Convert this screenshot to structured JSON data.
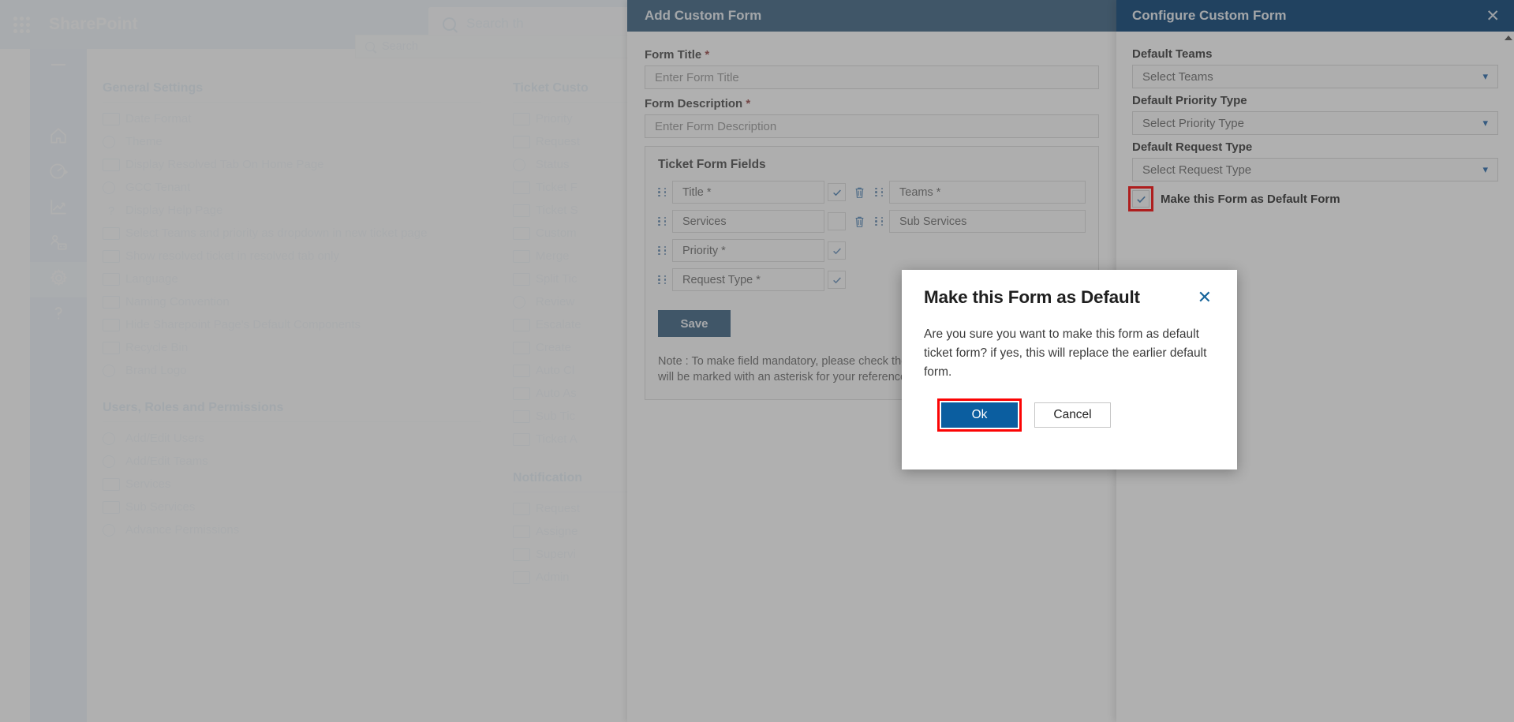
{
  "sharepoint": {
    "brand": "SharePoint",
    "waffle_icon": "app-launcher-icon",
    "search_placeholder": "Search th"
  },
  "app_search": {
    "placeholder": "Search"
  },
  "left_rail": {
    "items": [
      {
        "name": "menu-toggle",
        "icon": "hamburger-icon",
        "active": false
      },
      {
        "name": "home",
        "icon": "home-icon",
        "active": false
      },
      {
        "name": "dashboard",
        "icon": "gauge-icon",
        "active": false
      },
      {
        "name": "reports",
        "icon": "chart-line-icon",
        "active": false
      },
      {
        "name": "teams",
        "icon": "people-team-icon",
        "active": false
      },
      {
        "name": "settings",
        "icon": "gear-icon",
        "active": true
      },
      {
        "name": "help",
        "icon": "question-mark-icon",
        "active": false
      }
    ]
  },
  "settings": {
    "sections": [
      {
        "title": "General Settings",
        "items": [
          {
            "label": "Date Format",
            "icon": "calendar-clock-icon"
          },
          {
            "label": "Theme",
            "icon": "palette-icon"
          },
          {
            "label": "Display Resolved Tab On Home Page",
            "icon": "document-icon"
          },
          {
            "label": "GCC Tenant",
            "icon": "globe-icon"
          },
          {
            "label": "Display Help Page",
            "icon": "question-mark-icon"
          },
          {
            "label": "Select Teams and priority as dropdown in new ticket page",
            "icon": "dropdown-icon"
          },
          {
            "label": "Show resolved ticket in resolved tab only",
            "icon": "document-icon"
          },
          {
            "label": "Language",
            "icon": "language-icon"
          },
          {
            "label": "Naming Convention",
            "icon": "rename-icon"
          },
          {
            "label": "Hide Sharepoint Page's Default Components",
            "icon": "layout-icon"
          },
          {
            "label": "Recycle Bin",
            "icon": "recycle-bin-icon"
          },
          {
            "label": "Brand Logo",
            "icon": "badge-icon"
          }
        ]
      },
      {
        "title": "Users, Roles and Permissions",
        "items": [
          {
            "label": "Add/Edit Users",
            "icon": "people-icon"
          },
          {
            "label": "Add/Edit Teams",
            "icon": "people-team-icon"
          },
          {
            "label": "Services",
            "icon": "list-icon"
          },
          {
            "label": "Sub Services",
            "icon": "list-sub-icon"
          },
          {
            "label": "Advance Permissions",
            "icon": "key-icon"
          }
        ]
      }
    ],
    "sections_mid": [
      {
        "title": "Ticket Custo",
        "items": [
          {
            "label": "Priority",
            "icon": "priority-list-icon"
          },
          {
            "label": "Request",
            "icon": "request-edit-icon"
          },
          {
            "label": "Status",
            "icon": "clock-icon"
          },
          {
            "label": "Ticket F",
            "icon": "ticket-icon"
          },
          {
            "label": "Ticket S",
            "icon": "ticket-status-icon"
          },
          {
            "label": "Custom",
            "icon": "layers-icon"
          },
          {
            "label": "Merge ",
            "icon": "merge-icon"
          },
          {
            "label": "Split Tic",
            "icon": "split-icon"
          },
          {
            "label": "Review",
            "icon": "review-people-icon"
          },
          {
            "label": "Escalate",
            "icon": "escalate-chart-icon"
          },
          {
            "label": "Create ",
            "icon": "create-mail-icon"
          },
          {
            "label": "Auto Cl",
            "icon": "auto-close-icon"
          },
          {
            "label": "Auto As",
            "icon": "auto-assign-icon"
          },
          {
            "label": "Sub Tic",
            "icon": "sub-ticket-icon"
          },
          {
            "label": "Ticket A",
            "icon": "ticket-approval-icon"
          }
        ]
      },
      {
        "title": "Notification",
        "items": [
          {
            "label": "Request",
            "icon": "notification-icon"
          },
          {
            "label": "Assigne",
            "icon": "notification-icon"
          },
          {
            "label": "Supervi",
            "icon": "notification-icon"
          },
          {
            "label": "Admin",
            "icon": "notification-icon"
          }
        ]
      }
    ]
  },
  "add_form_panel": {
    "title": "Add Custom Form",
    "form_title_label": "Form Title",
    "form_title_required": "*",
    "form_title_placeholder": "Enter Form Title",
    "form_desc_label": "Form Description",
    "form_desc_required": "*",
    "form_desc_placeholder": "Enter Form Description",
    "fields_heading": "Ticket Form Fields",
    "fields_left": [
      {
        "label": "Title *",
        "checked": true,
        "deletable": true
      },
      {
        "label": "Services",
        "checked": false,
        "deletable": true
      },
      {
        "label": "Priority *",
        "checked": true,
        "deletable": true
      },
      {
        "label": "Request Type *",
        "checked": true,
        "deletable": true
      }
    ],
    "fields_right": [
      {
        "label": "Teams *",
        "checked": true,
        "deletable": true
      },
      {
        "label": "Sub Services",
        "checked": false,
        "deletable": true
      }
    ],
    "save_label": "Save",
    "note": "Note : To make field mandatory, please check the checkbox. Mandatory fields will be marked with an asterisk for your reference."
  },
  "configure_panel": {
    "title": "Configure Custom Form",
    "close_icon": "close-icon",
    "fields": [
      {
        "label": "Default Teams",
        "value": "Select Teams",
        "icon": "chevron-down-icon"
      },
      {
        "label": "Default Priority Type",
        "value": "Select Priority Type",
        "icon": "chevron-down-icon"
      },
      {
        "label": "Default Request Type",
        "value": "Select Request Type",
        "icon": "chevron-down-icon"
      }
    ],
    "default_form_checkbox": {
      "label": "Make this Form as Default Form",
      "checked": true,
      "highlighted": true
    },
    "scroll_up_icon": "scroll-up-arrow-icon"
  },
  "modal": {
    "title": "Make this Form as Default",
    "close_icon": "close-icon",
    "body": "Are you sure you want to make this form as default ticket form? if yes, this will replace the earlier default form.",
    "ok_label": "Ok",
    "cancel_label": "Cancel",
    "highlight_color": "#fb0404",
    "ok_color": "#0b5ea0"
  }
}
